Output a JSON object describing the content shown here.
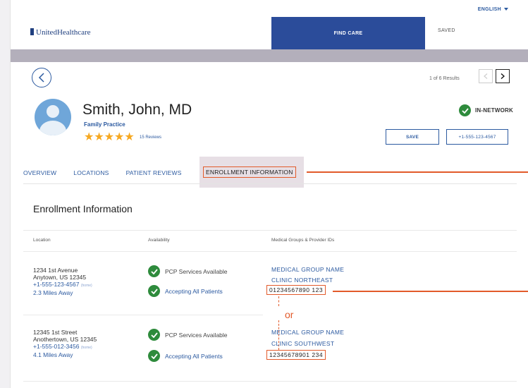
{
  "header": {
    "language": "ENGLISH",
    "logo": "UnitedHealthcare",
    "nav_find_care": "FIND CARE",
    "nav_saved": "SAVED"
  },
  "pagination": {
    "results_text": "1 of 6 Results"
  },
  "provider": {
    "name": "Smith, John, MD",
    "specialty": "Family Practice",
    "stars": "★★★★★",
    "rating": 4.5,
    "reviews": "15 Reviews",
    "network_status": "IN-NETWORK",
    "save_label": "SAVE",
    "phone": "+1-555-123-4567"
  },
  "tabs": {
    "overview": "OVERVIEW",
    "locations": "LOCATIONS",
    "patient_reviews": "PATIENT REVIEWS",
    "enrollment": "ENROLLMENT INFORMATION"
  },
  "enrollment": {
    "title": "Enrollment Information",
    "columns": {
      "location": "Location",
      "availability": "Availability",
      "groups": "Medical Groups & Provider IDs"
    },
    "rows": [
      {
        "street": "1234 1st Avenue",
        "city": "Anytown, US 12345",
        "phone": "+1-555-123-4567",
        "phone_tag": "(home)",
        "distance": "2.3 Miles Away",
        "avail_1": "PCP Services Available",
        "avail_2": "Accepting All Patients",
        "group_name": "MEDICAL GROUP NAME",
        "clinic": "CLINIC NORTHEAST",
        "provider_id": "01234567890 123"
      },
      {
        "street": "12345 1st Street",
        "city": "Anothertown, US 12345",
        "phone": "+1-555-012-3456",
        "phone_tag": "(home)",
        "distance": "4.1 Miles Away",
        "avail_1": "PCP Services Available",
        "avail_2": "Accepting All Patients",
        "group_name": "MEDICAL GROUP NAME",
        "clinic": "CLINIC SOUTHWEST",
        "provider_id": "12345678901 234"
      }
    ],
    "or_label": "or"
  },
  "colors": {
    "brand_blue": "#2b4c9a",
    "link_blue": "#2c5aa0",
    "annotation_orange": "#e25a2a",
    "star_gold": "#f6a821",
    "check_green": "#2e8b3c"
  }
}
